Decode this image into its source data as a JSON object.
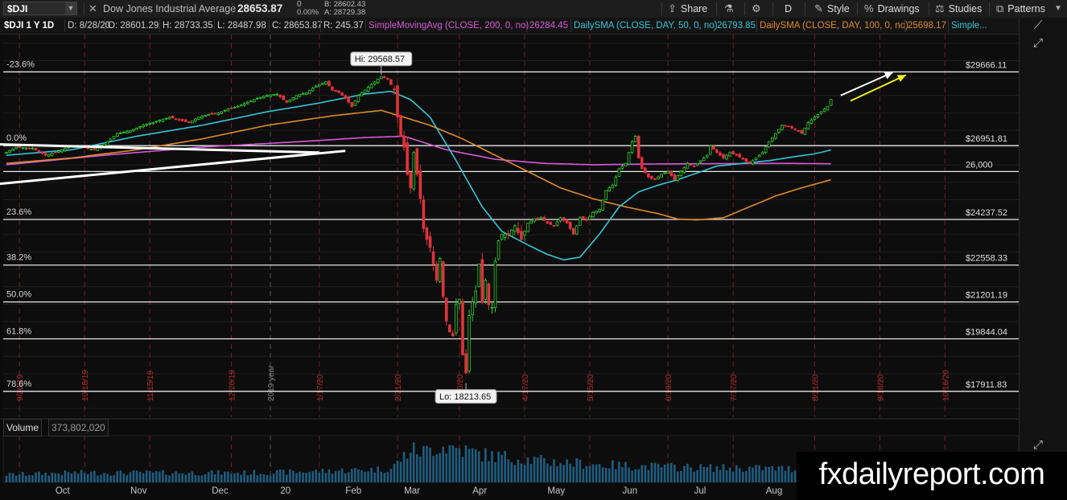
{
  "toolbar": {
    "symbol": "$DJI",
    "name": "Dow Jones Industrial Average",
    "last": "28653.87",
    "change": "0",
    "change_pct": "0.00%",
    "bid": "B: 28602.43",
    "ask": "A: 28729.38",
    "share": "Share",
    "period": "D",
    "style": "Style",
    "drawings": "Drawings",
    "studies": "Studies",
    "patterns": "Patterns"
  },
  "infobar": {
    "title": "$DJI 1 Y 1D",
    "date": "D: 8/28/20",
    "open": "O: 28601.29",
    "high": "H: 28733.35",
    "low": "L: 28487.98",
    "close": "C: 28653.87",
    "range": "R: 245.37",
    "sma200_label": "SimpleMovingAvg (CLOSE, 200, 0, no)",
    "sma200_val": "26284.45",
    "sma50_label": "DailySMA (CLOSE, DAY, 50, 0, no)",
    "sma50_val": "26793.85",
    "sma100_label": "DailySMA (CLOSE, DAY, 100, 0, no)",
    "sma100_val": "25698.17",
    "more": "Simple..."
  },
  "volume": {
    "label": "Volume",
    "value": "373,802,020"
  },
  "watermark": "fxdailyreport.com",
  "chart_data": {
    "type": "candlestick",
    "title": "$DJI 1 Y 1D",
    "ylim": [
      16960,
      31040
    ],
    "y_ticks": [
      30720,
      30080,
      29440,
      28800,
      28160,
      27520,
      26880,
      26240,
      25600,
      24960,
      24320,
      23680,
      23040,
      22400,
      21760,
      21120,
      20480,
      19840,
      19200,
      18560,
      17920,
      17280
    ],
    "x_month_labels": [
      "Oct",
      "Nov",
      "Dec",
      "20",
      "Feb",
      "Mar",
      "Apr",
      "May",
      "Jun",
      "Jul",
      "Aug"
    ],
    "x_month_index": [
      17,
      40,
      65,
      86,
      106,
      124,
      145,
      168,
      191,
      213,
      235
    ],
    "date_markers": [
      "9/20/19",
      "10/18/19",
      "11/15/19",
      "12/20/19",
      "2019 year",
      "1/17/20",
      "2/21/20",
      "3/20/20",
      "4/17/20",
      "5/15/20",
      "6/19/20",
      "7/17/20",
      "8/21/20",
      "9/18/20",
      "10/16/20"
    ],
    "date_marker_index": [
      4,
      24,
      44,
      69,
      81,
      96,
      120,
      139,
      159,
      179,
      203,
      223,
      248,
      268,
      288
    ],
    "fib_levels": [
      {
        "label": "-23.6%",
        "price": 29666.11,
        "price_label": "$29666.11"
      },
      {
        "label": "0.0%",
        "price": 26951.81,
        "price_label": "$26951.81"
      },
      {
        "label": "",
        "price": 26000,
        "price_label": "26,000"
      },
      {
        "label": "23.6%",
        "price": 24237.52,
        "price_label": "$24237.52"
      },
      {
        "label": "38.2%",
        "price": 22558.33,
        "price_label": "$22558.33"
      },
      {
        "label": "50.0%",
        "price": 21201.19,
        "price_label": "$21201.19"
      },
      {
        "label": "61.8%",
        "price": 19844.04,
        "price_label": "$19844.04"
      },
      {
        "label": "78.6%",
        "price": 17911.83,
        "price_label": "$17911.83"
      }
    ],
    "annotations": [
      {
        "text": "Hi: 29568.57",
        "x_index": 115,
        "price": 29568.57
      },
      {
        "text": "Lo: 18213.65",
        "x_index": 141,
        "price": 18213.65
      }
    ],
    "last_price_tags": [
      {
        "value": "28653.87",
        "price": 28653.87,
        "color": "#2ecc2e"
      },
      {
        "value": "26793.85",
        "price": 26793.85,
        "color": "#35c6d8"
      },
      {
        "value": "26284.45",
        "price": 26284.45,
        "color": "#d85ad8"
      },
      {
        "value": "25698.17",
        "price": 25698.17,
        "color": "#e08a2a"
      }
    ],
    "close_anchors": [
      [
        0,
        26700
      ],
      [
        3,
        26900
      ],
      [
        8,
        26850
      ],
      [
        12,
        26600
      ],
      [
        16,
        26750
      ],
      [
        20,
        26950
      ],
      [
        24,
        26900
      ],
      [
        27,
        26800
      ],
      [
        30,
        27000
      ],
      [
        34,
        27400
      ],
      [
        38,
        27500
      ],
      [
        42,
        27700
      ],
      [
        46,
        27850
      ],
      [
        50,
        28000
      ],
      [
        53,
        27900
      ],
      [
        56,
        27800
      ],
      [
        59,
        28000
      ],
      [
        62,
        28100
      ],
      [
        65,
        28150
      ],
      [
        68,
        28300
      ],
      [
        71,
        28400
      ],
      [
        74,
        28550
      ],
      [
        77,
        28700
      ],
      [
        80,
        28800
      ],
      [
        83,
        28850
      ],
      [
        86,
        28550
      ],
      [
        89,
        28800
      ],
      [
        92,
        28900
      ],
      [
        95,
        29150
      ],
      [
        98,
        29300
      ],
      [
        100,
        29000
      ],
      [
        102,
        28900
      ],
      [
        104,
        28700
      ],
      [
        106,
        28400
      ],
      [
        108,
        28800
      ],
      [
        111,
        29100
      ],
      [
        113,
        29300
      ],
      [
        115,
        29500
      ],
      [
        117,
        29400
      ],
      [
        119,
        29000
      ],
      [
        120,
        28000
      ],
      [
        121,
        27300
      ],
      [
        122,
        26900
      ],
      [
        123,
        25900
      ],
      [
        124,
        25400
      ],
      [
        125,
        26700
      ],
      [
        126,
        25900
      ],
      [
        127,
        25000
      ],
      [
        128,
        23900
      ],
      [
        129,
        23500
      ],
      [
        130,
        23200
      ],
      [
        131,
        22600
      ],
      [
        132,
        22000
      ],
      [
        133,
        22800
      ],
      [
        134,
        21400
      ],
      [
        135,
        20500
      ],
      [
        136,
        20100
      ],
      [
        137,
        19950
      ],
      [
        138,
        21100
      ],
      [
        139,
        21300
      ],
      [
        140,
        19250
      ],
      [
        141,
        18590
      ],
      [
        142,
        20700
      ],
      [
        143,
        21200
      ],
      [
        144,
        21600
      ],
      [
        145,
        22600
      ],
      [
        146,
        21200
      ],
      [
        147,
        22000
      ],
      [
        148,
        21100
      ],
      [
        149,
        21000
      ],
      [
        150,
        22700
      ],
      [
        151,
        23450
      ],
      [
        152,
        23700
      ],
      [
        154,
        23700
      ],
      [
        156,
        24000
      ],
      [
        158,
        23500
      ],
      [
        160,
        24100
      ],
      [
        162,
        24250
      ],
      [
        164,
        24300
      ],
      [
        166,
        24100
      ],
      [
        168,
        24000
      ],
      [
        170,
        24300
      ],
      [
        172,
        24100
      ],
      [
        174,
        23700
      ],
      [
        176,
        24300
      ],
      [
        178,
        24200
      ],
      [
        180,
        24500
      ],
      [
        182,
        24600
      ],
      [
        184,
        25300
      ],
      [
        186,
        25500
      ],
      [
        188,
        26100
      ],
      [
        190,
        26300
      ],
      [
        192,
        27100
      ],
      [
        193,
        27300
      ],
      [
        194,
        26500
      ],
      [
        195,
        26100
      ],
      [
        197,
        25800
      ],
      [
        199,
        25700
      ],
      [
        201,
        25900
      ],
      [
        203,
        26000
      ],
      [
        205,
        25700
      ],
      [
        207,
        26000
      ],
      [
        209,
        26300
      ],
      [
        211,
        26200
      ],
      [
        213,
        26400
      ],
      [
        215,
        26600
      ],
      [
        216,
        26950
      ],
      [
        218,
        26700
      ],
      [
        220,
        26500
      ],
      [
        222,
        26700
      ],
      [
        224,
        26600
      ],
      [
        226,
        26450
      ],
      [
        228,
        26300
      ],
      [
        230,
        26500
      ],
      [
        232,
        26700
      ],
      [
        234,
        27100
      ],
      [
        236,
        27400
      ],
      [
        238,
        27700
      ],
      [
        240,
        27650
      ],
      [
        242,
        27550
      ],
      [
        244,
        27400
      ],
      [
        246,
        27800
      ],
      [
        248,
        28000
      ],
      [
        250,
        28200
      ],
      [
        252,
        28400
      ],
      [
        253,
        28653.87
      ]
    ],
    "sma50_anchors": [
      [
        0,
        26600
      ],
      [
        20,
        26800
      ],
      [
        40,
        27300
      ],
      [
        60,
        27700
      ],
      [
        80,
        28200
      ],
      [
        95,
        28500
      ],
      [
        110,
        28850
      ],
      [
        118,
        28950
      ],
      [
        124,
        28650
      ],
      [
        130,
        28000
      ],
      [
        138,
        26400
      ],
      [
        146,
        24700
      ],
      [
        152,
        23800
      ],
      [
        160,
        23300
      ],
      [
        166,
        22950
      ],
      [
        171,
        22750
      ],
      [
        176,
        22850
      ],
      [
        182,
        23700
      ],
      [
        188,
        24700
      ],
      [
        194,
        25250
      ],
      [
        200,
        25500
      ],
      [
        206,
        25700
      ],
      [
        212,
        25950
      ],
      [
        218,
        26200
      ],
      [
        226,
        26300
      ],
      [
        234,
        26400
      ],
      [
        242,
        26550
      ],
      [
        248,
        26650
      ],
      [
        253,
        26793.85
      ]
    ],
    "sma100_anchors": [
      [
        0,
        26300
      ],
      [
        20,
        26500
      ],
      [
        40,
        26800
      ],
      [
        60,
        27200
      ],
      [
        80,
        27700
      ],
      [
        100,
        28050
      ],
      [
        115,
        28250
      ],
      [
        122,
        28000
      ],
      [
        130,
        27700
      ],
      [
        140,
        27200
      ],
      [
        150,
        26600
      ],
      [
        160,
        26000
      ],
      [
        170,
        25400
      ],
      [
        180,
        25000
      ],
      [
        190,
        24700
      ],
      [
        200,
        24450
      ],
      [
        206,
        24250
      ],
      [
        212,
        24220
      ],
      [
        220,
        24300
      ],
      [
        228,
        24700
      ],
      [
        236,
        25100
      ],
      [
        244,
        25400
      ],
      [
        253,
        25698.17
      ]
    ],
    "sma200_anchors": [
      [
        0,
        26250
      ],
      [
        30,
        26600
      ],
      [
        60,
        26900
      ],
      [
        90,
        27100
      ],
      [
        110,
        27250
      ],
      [
        122,
        27300
      ],
      [
        135,
        26800
      ],
      [
        150,
        26450
      ],
      [
        165,
        26300
      ],
      [
        180,
        26250
      ],
      [
        200,
        26280
      ],
      [
        220,
        26290
      ],
      [
        240,
        26300
      ],
      [
        253,
        26284.45
      ]
    ],
    "volume_anchors": [
      [
        0,
        0.2
      ],
      [
        20,
        0.25
      ],
      [
        40,
        0.25
      ],
      [
        60,
        0.25
      ],
      [
        80,
        0.25
      ],
      [
        100,
        0.3
      ],
      [
        118,
        0.35
      ],
      [
        124,
        0.85
      ],
      [
        128,
        0.8
      ],
      [
        133,
        0.95
      ],
      [
        138,
        0.9
      ],
      [
        142,
        0.8
      ],
      [
        148,
        0.7
      ],
      [
        155,
        0.65
      ],
      [
        165,
        0.55
      ],
      [
        175,
        0.5
      ],
      [
        185,
        0.45
      ],
      [
        195,
        0.42
      ],
      [
        205,
        0.4
      ],
      [
        215,
        0.38
      ],
      [
        230,
        0.37
      ],
      [
        245,
        0.35
      ],
      [
        253,
        0.3
      ]
    ],
    "trendlines": [
      {
        "x1": 0,
        "p1": 27000,
        "x2": 96,
        "p2": 26700
      },
      {
        "x1": 0,
        "p1": 25550,
        "x2": 104,
        "p2": 26760
      }
    ],
    "arrows": [
      {
        "x1": 256,
        "p1": 28800,
        "x2": 272,
        "p2": 29650,
        "color": "#ffffff"
      },
      {
        "x1": 259,
        "p1": 28600,
        "x2": 276,
        "p2": 29550,
        "color": "#f0f020"
      }
    ]
  }
}
